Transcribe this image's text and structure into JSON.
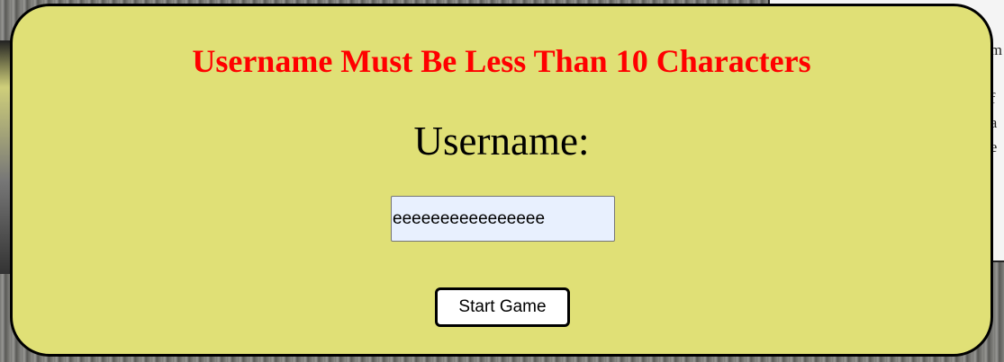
{
  "dialog": {
    "error_message": "Username Must Be Less Than 10 Characters",
    "username_label": "Username:",
    "username_value": "eeeeeeeeeeeeeeee",
    "start_button_label": "Start Game",
    "error_color": "#ff0000",
    "background_color": "#e0e076"
  },
  "background_page": {
    "text_fragments": [
      "m",
      ",",
      "f",
      "a",
      "e"
    ]
  }
}
